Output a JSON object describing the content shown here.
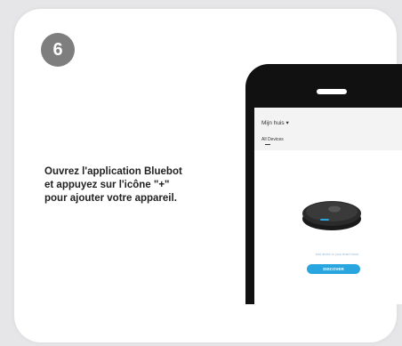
{
  "step": {
    "number": "6"
  },
  "instruction": {
    "line1": "Ouvrez l'application Bluebot",
    "line2": "et appuyez sur l'icône \"+\"",
    "line3": "pour ajouter votre appareil."
  },
  "phone_screen": {
    "home_title": "Mijn huis ▾",
    "add_icon": "+",
    "devices_tab": "All Devices",
    "more_icon": "…",
    "hint": "Add device to your smart home",
    "discover_button": "DISCOVER"
  },
  "colors": {
    "badge": "#7e7e7e",
    "accent_button": "#29a6df",
    "phone_body": "#111111"
  }
}
